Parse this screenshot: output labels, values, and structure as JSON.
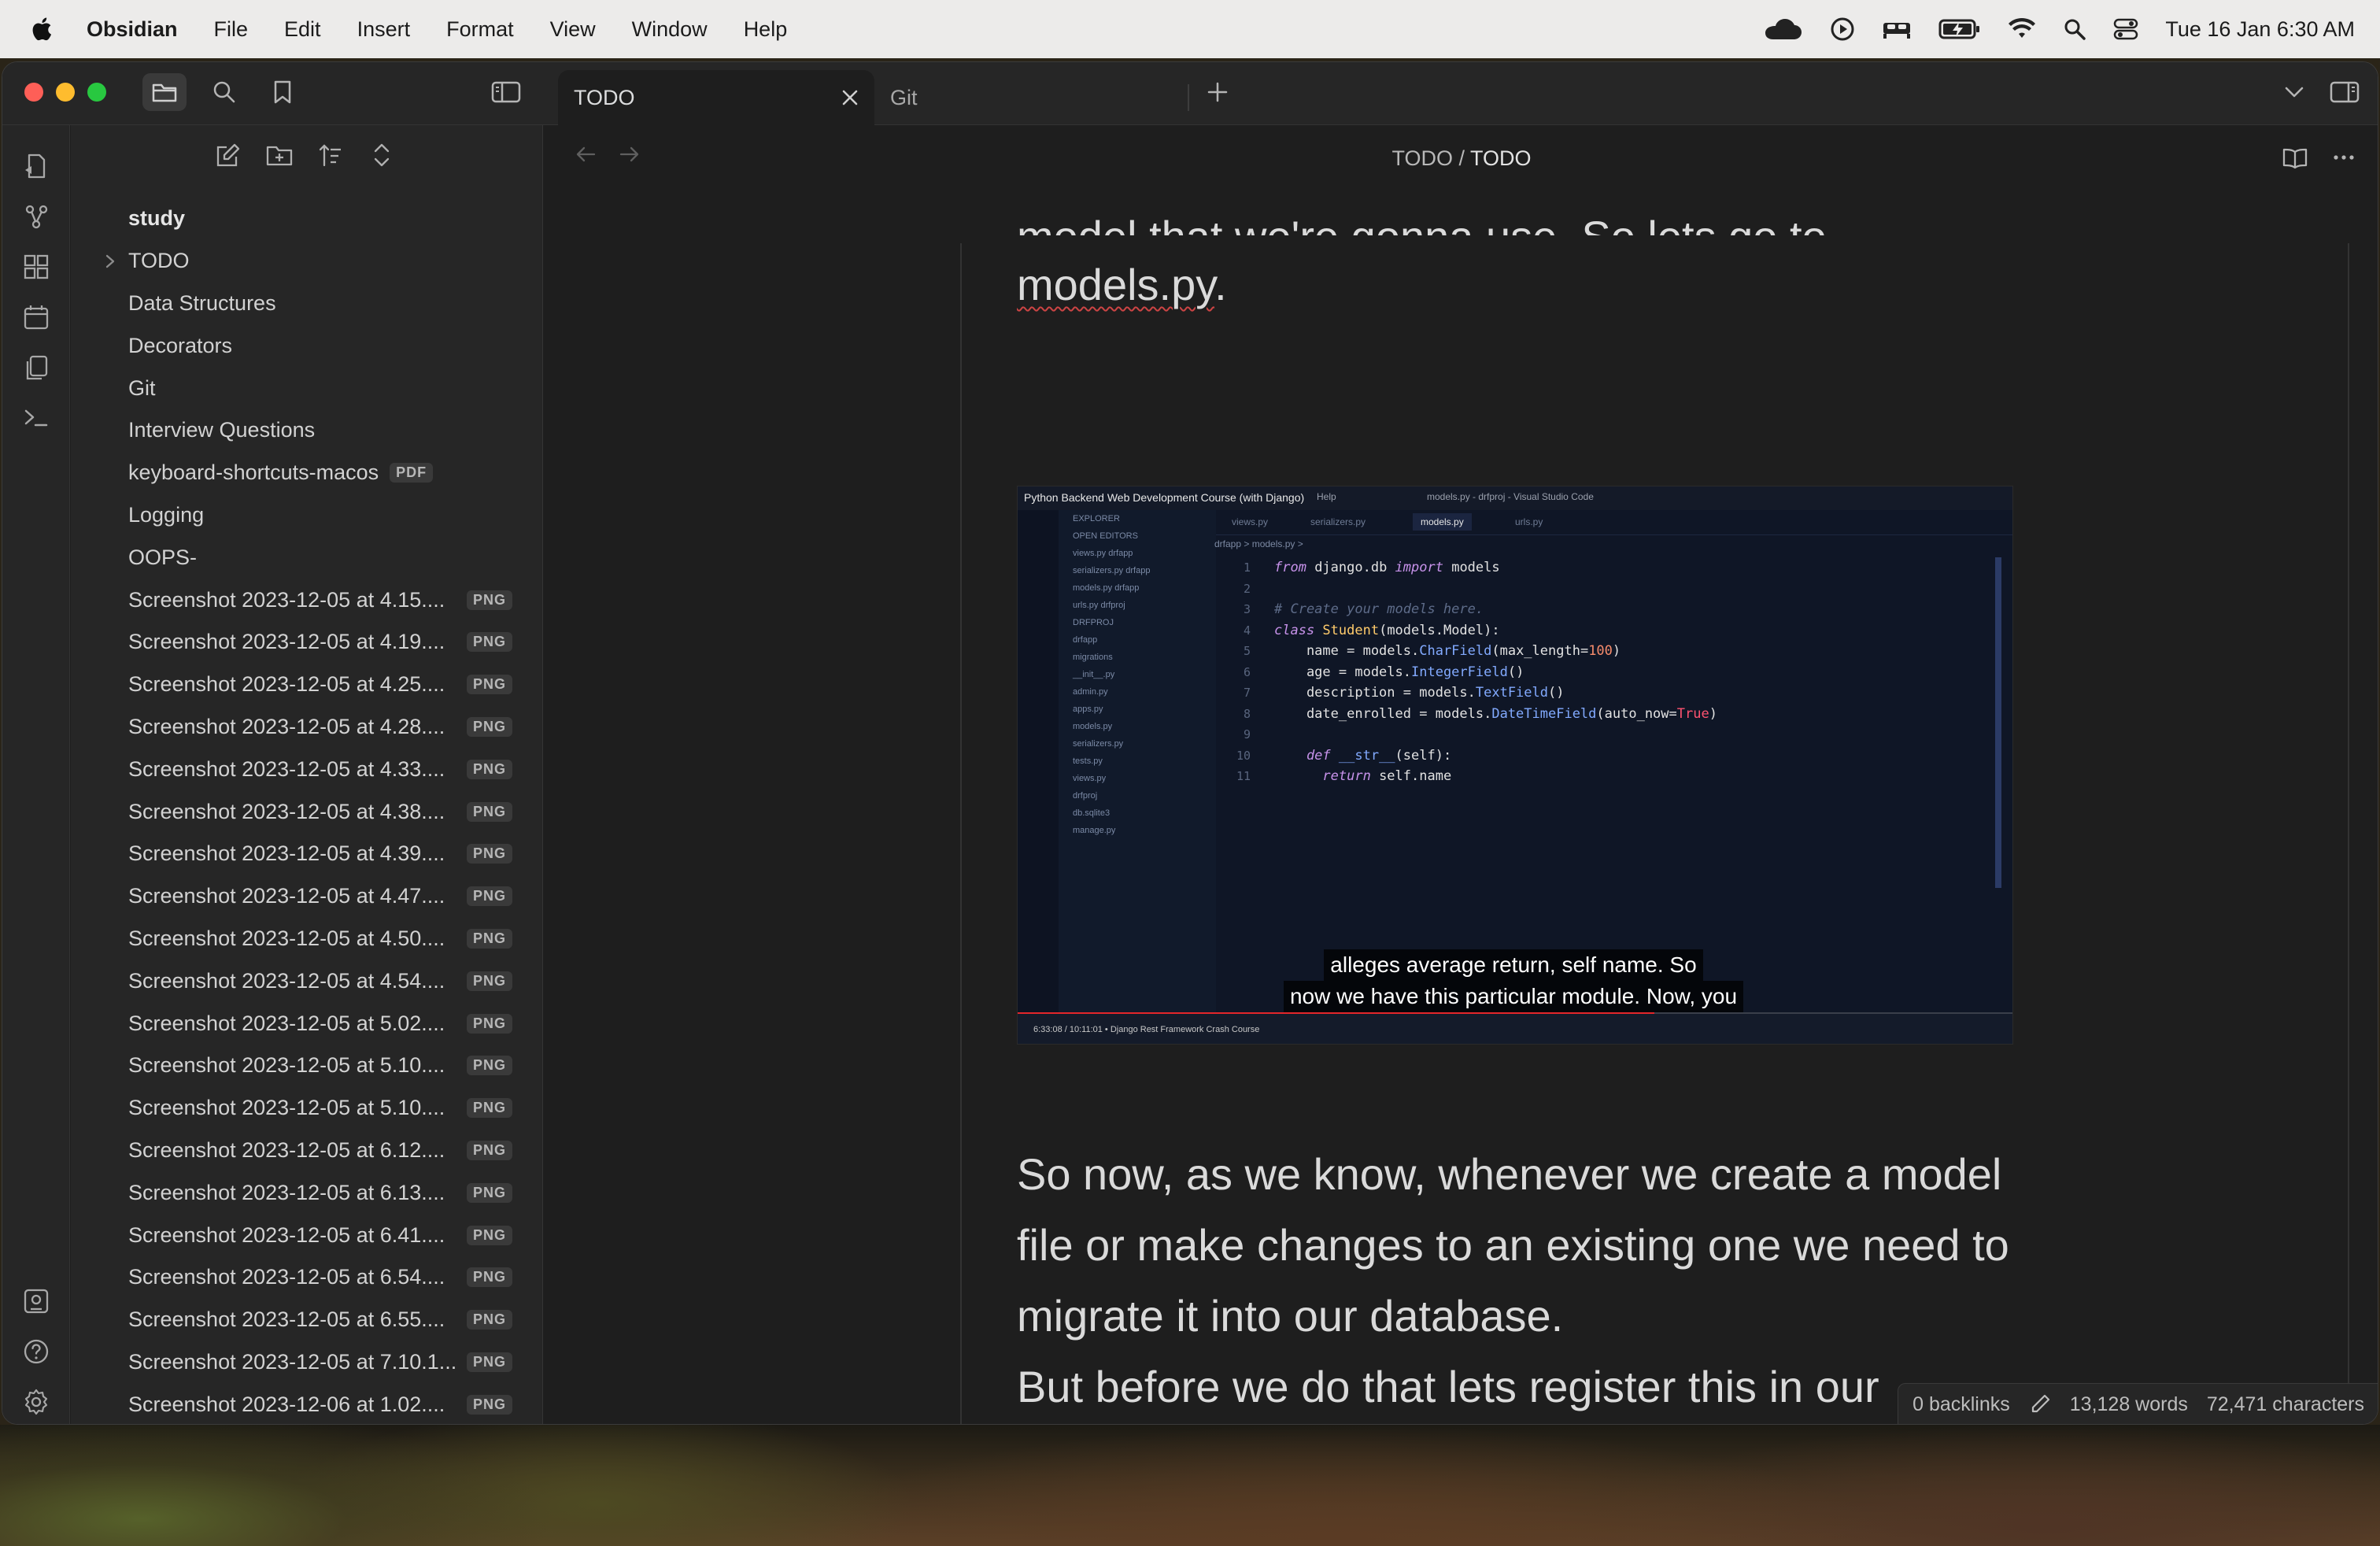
{
  "menubar": {
    "app_name": "Obsidian",
    "menus": [
      "File",
      "Edit",
      "Insert",
      "Format",
      "View",
      "Window",
      "Help"
    ],
    "clock": "Tue 16 Jan  6:30 AM",
    "status_icons": [
      "creative-cloud-icon",
      "play-icon",
      "bed-icon",
      "battery-icon",
      "wifi-icon",
      "spotlight-search-icon",
      "control-center-icon"
    ]
  },
  "tabs": [
    {
      "label": "TODO",
      "active": true
    },
    {
      "label": "Git",
      "active": false
    }
  ],
  "breadcrumb": {
    "parent": "TODO",
    "separator": "/",
    "current": "TODO"
  },
  "sidebar": {
    "root": "study",
    "items": [
      {
        "name": "TODO",
        "folder": true
      },
      {
        "name": "Data Structures"
      },
      {
        "name": "Decorators"
      },
      {
        "name": "Git"
      },
      {
        "name": "Interview Questions"
      },
      {
        "name": "keyboard-shortcuts-macos",
        "badge": "PDF"
      },
      {
        "name": "Logging"
      },
      {
        "name": "OOPS-"
      },
      {
        "name": "Screenshot 2023-12-05 at 4.15....",
        "badge": "PNG"
      },
      {
        "name": "Screenshot 2023-12-05 at 4.19....",
        "badge": "PNG"
      },
      {
        "name": "Screenshot 2023-12-05 at 4.25....",
        "badge": "PNG"
      },
      {
        "name": "Screenshot 2023-12-05 at 4.28....",
        "badge": "PNG"
      },
      {
        "name": "Screenshot 2023-12-05 at 4.33....",
        "badge": "PNG"
      },
      {
        "name": "Screenshot 2023-12-05 at 4.38....",
        "badge": "PNG"
      },
      {
        "name": "Screenshot 2023-12-05 at 4.39....",
        "badge": "PNG"
      },
      {
        "name": "Screenshot 2023-12-05 at 4.47....",
        "badge": "PNG"
      },
      {
        "name": "Screenshot 2023-12-05 at 4.50....",
        "badge": "PNG"
      },
      {
        "name": "Screenshot 2023-12-05 at 4.54....",
        "badge": "PNG"
      },
      {
        "name": "Screenshot 2023-12-05 at 5.02....",
        "badge": "PNG"
      },
      {
        "name": "Screenshot 2023-12-05 at 5.10....",
        "badge": "PNG"
      },
      {
        "name": "Screenshot 2023-12-05 at 5.10....",
        "badge": "PNG"
      },
      {
        "name": "Screenshot 2023-12-05 at 6.12....",
        "badge": "PNG"
      },
      {
        "name": "Screenshot 2023-12-05 at 6.13....",
        "badge": "PNG"
      },
      {
        "name": "Screenshot 2023-12-05 at 6.41....",
        "badge": "PNG"
      },
      {
        "name": "Screenshot 2023-12-05 at 6.54....",
        "badge": "PNG"
      },
      {
        "name": "Screenshot 2023-12-05 at 6.55....",
        "badge": "PNG"
      },
      {
        "name": "Screenshot 2023-12-05 at 7.10.1...",
        "badge": "PNG"
      },
      {
        "name": "Screenshot 2023-12-06 at 1.02....",
        "badge": "PNG"
      }
    ]
  },
  "document": {
    "fragment_top": "model that we're gonna use. So lets go to",
    "line1_link": "models.py",
    "line1_end": ".",
    "para2": "So now, as we know, whenever we create a model file or make changes to an existing one we need to migrate it into our database.",
    "para3": "But before we do that lets register this in our INSTALLED_APPS."
  },
  "embedded_image": {
    "title": "Python Backend Web Development Course (with Django)",
    "help": "Help",
    "window_title": "models.py - drfproj - Visual Studio Code",
    "tabs": [
      "views.py",
      "serializers.py",
      "models.py",
      "urls.py"
    ],
    "crumb": "drfapp > models.py >",
    "explorer_lines": [
      "EXPLORER",
      "OPEN EDITORS",
      "views.py drfapp",
      "serializers.py drfapp",
      "models.py drfapp",
      "urls.py drfproj",
      "DRFPROJ",
      "drfapp",
      "migrations",
      "__init__.py",
      "admin.py",
      "apps.py",
      "models.py",
      "serializers.py",
      "tests.py",
      "views.py",
      "drfproj",
      "db.sqlite3",
      "manage.py"
    ],
    "code": {
      "l1_kw1": "from",
      "l1_mod": " django.db ",
      "l1_kw2": "import",
      "l1_rest": " models",
      "l3": "# Create your models here.",
      "l4_kw": "class",
      "l4_cls": " Student",
      "l4_rest": "(models.Model):",
      "l5_a": "    name = models.",
      "l5_fn": "CharField",
      "l5_b": "(max_length=",
      "l5_n": "100",
      "l5_c": ")",
      "l6_a": "    age = models.",
      "l6_fn": "IntegerField",
      "l6_b": "()",
      "l7_a": "    description = models.",
      "l7_fn": "TextField",
      "l7_b": "()",
      "l8_a": "    date_enrolled = models.",
      "l8_fn": "DateTimeField",
      "l8_b": "(auto_now=",
      "l8_t": "True",
      "l8_c": ")",
      "l10_kw": "    def",
      "l10_fn": " __str__",
      "l10_b": "(self):",
      "l11_kw": "      return",
      "l11_b": " self.name"
    },
    "caption_line1": "alleges average return, self name. So",
    "caption_line2": "now we have this particular module. Now, you",
    "player_text": "6:33:08 / 10:11:01 • Django Rest Framework Crash Course",
    "progress": 0.64
  },
  "statusbar": {
    "backlinks": "0 backlinks",
    "words": "13,128 words",
    "characters": "72,471 characters"
  },
  "colors": {
    "accent_red": "#e4262a",
    "window_bg": "#1e1e1e",
    "sidebar_bg": "#262626"
  }
}
